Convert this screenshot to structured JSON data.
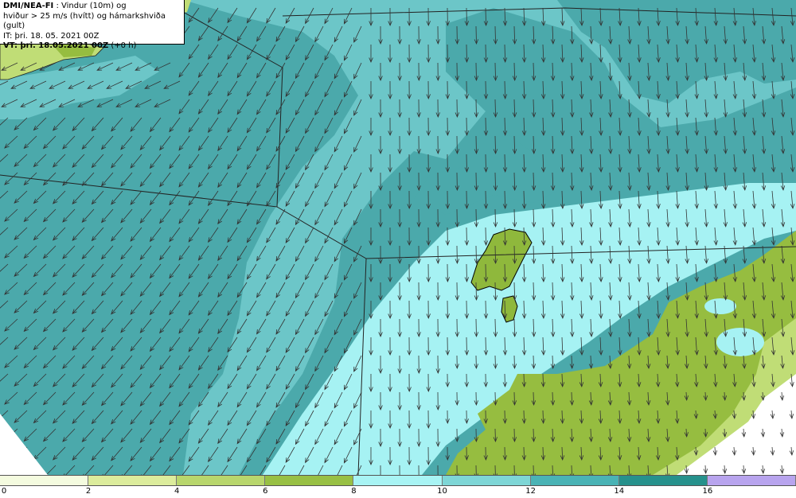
{
  "header": {
    "line1_bold": "DMI/NEA-FI",
    "line1_rest": " : Vindur (10m) og",
    "line2": "hviður > 25 m/s (hvítt) og hámarkshviða (gult)",
    "line3": "IT: þri. 18. 05. 2021 00Z",
    "line4_bold": "VT: þri. 18.05.2021 00Z",
    "line4_rest": " (+0 h)"
  },
  "legend": {
    "ticks": [
      "0",
      "2",
      "4",
      "6",
      "8",
      "10",
      "12",
      "14",
      "16"
    ],
    "colors": [
      "#f4fbdf",
      "#dcec9c",
      "#b8d66c",
      "#98c044",
      "#a8f4f4",
      "#7ed6d6",
      "#4ab3b5",
      "#26918c",
      "#b8a4ee"
    ]
  },
  "map_colors": {
    "dark_teal": "#4ba9ab",
    "mid_teal": "#6cc6c8",
    "light_cyan": "#a6f2f3",
    "green": "#96bd40",
    "light_green": "#c0dd76",
    "island": "#8fb83c",
    "lines": "#222222",
    "arrows": "#333333"
  },
  "wind": {
    "description_direction": "southward"
  }
}
